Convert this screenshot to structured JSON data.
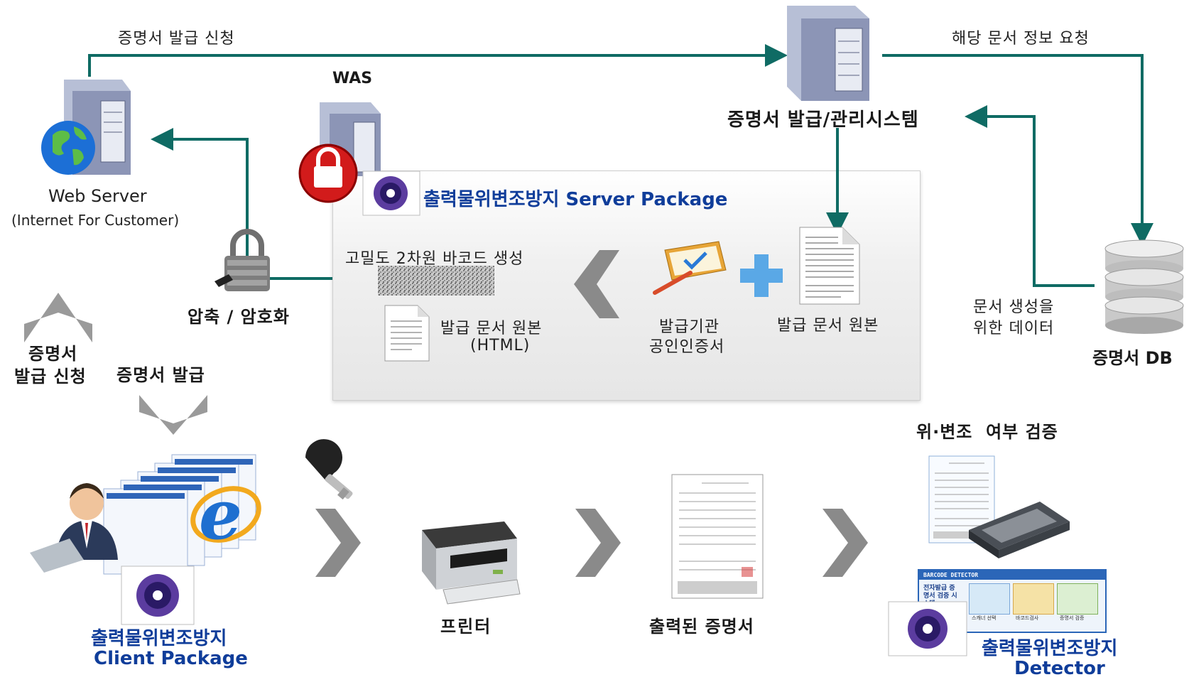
{
  "top_flow": {
    "request_label": "증명서 발급 신청",
    "info_request_label": "해당 문서 정보 요청"
  },
  "web_server": {
    "title": "Web Server",
    "subtitle": "(Internet For Customer)"
  },
  "was": {
    "title": "WAS"
  },
  "issue_system": {
    "title": "증명서 발급/관리시스템"
  },
  "server_package": {
    "title": "출력물위변조방지 Server Package"
  },
  "panel": {
    "barcode_label": "고밀도 2차원 바코드 생성",
    "html_doc_line1": "발급 문서 원본",
    "html_doc_line2": "(HTML)",
    "cert_line1": "발급기관",
    "cert_line2": "공인인증서",
    "original_doc": "발급 문서 원본"
  },
  "compress": {
    "label": "압축 / 암호화"
  },
  "db": {
    "label": "증명서 DB",
    "data_line1": "문서 생성을",
    "data_line2": "위한 데이터"
  },
  "client_flow": {
    "request_line1": "증명서",
    "request_line2": "발급 신청",
    "issue_label": "증명서 발급"
  },
  "client_package": {
    "line1": "출력물위변조방지",
    "line2": "Client Package"
  },
  "printer": {
    "label": "프린터"
  },
  "printed": {
    "label": "출력된 증명서"
  },
  "verify": {
    "label": "위·변조  여부 검증"
  },
  "detector": {
    "line1": "출력물위변조방지",
    "line2": "Detector",
    "window_title": "BARCODE DETECTOR",
    "window_heading": "전자발급 증명서 검증 시스템",
    "step1": "스캐너 선택",
    "step2": "바코드검사",
    "step3": "증명서 검증"
  },
  "colors": {
    "arrow": "#0f6b64",
    "accent_blue": "#0f3d9a",
    "chevron": "#8a8a8a"
  }
}
